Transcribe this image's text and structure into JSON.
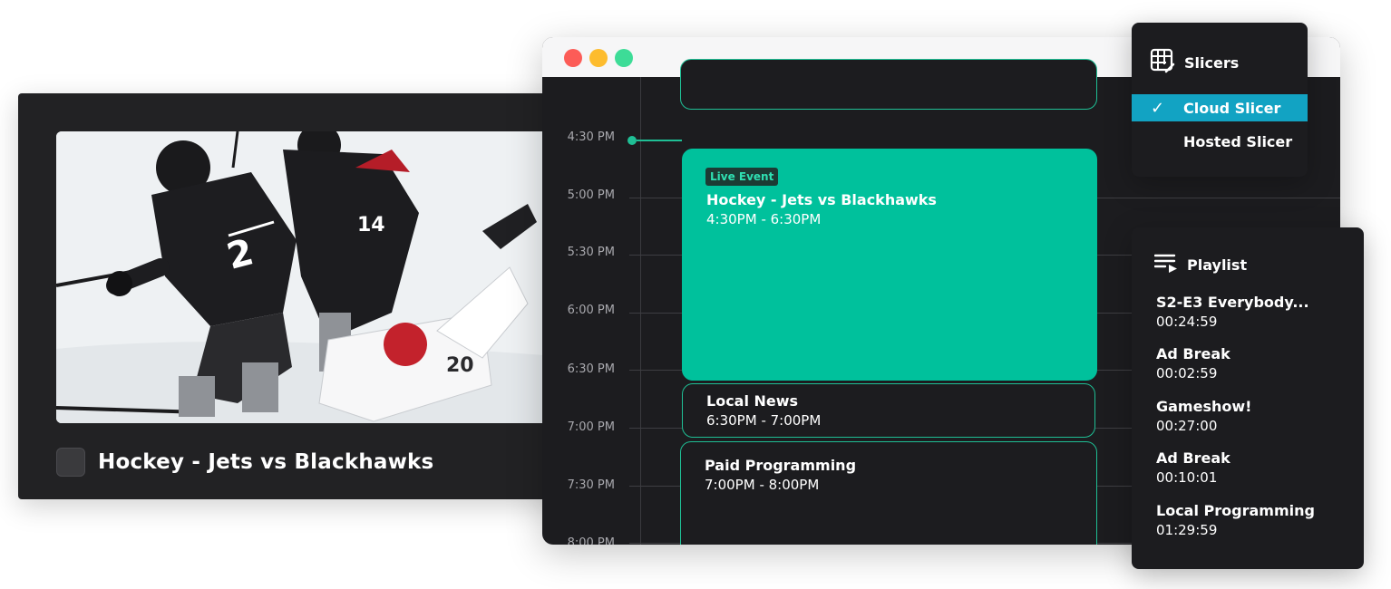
{
  "player": {
    "title": "Hockey - Jets vs Blackhawks"
  },
  "schedule": {
    "times": [
      "4:30 PM",
      "5:00 PM",
      "5:30 PM",
      "6:00 PM",
      "6:30 PM",
      "7:00 PM",
      "7:30 PM",
      "8:00 PM"
    ],
    "events": [
      {
        "badge": "Live Event",
        "title": "Hockey - Jets vs Blackhawks",
        "time": "4:30PM - 6:30PM"
      },
      {
        "title": "Local News",
        "time": "6:30PM - 7:00PM"
      },
      {
        "title": "Paid Programming",
        "time": "7:00PM - 8:00PM"
      }
    ]
  },
  "slicers": {
    "title": "Slicers",
    "options": [
      {
        "label": "Cloud Slicer",
        "selected": true
      },
      {
        "label": "Hosted Slicer",
        "selected": false
      }
    ]
  },
  "playlist": {
    "title": "Playlist",
    "items": [
      {
        "name": "S2-E3 Everybody...",
        "duration": "00:24:59"
      },
      {
        "name": "Ad Break",
        "duration": "00:02:59"
      },
      {
        "name": "Gameshow!",
        "duration": "00:27:00"
      },
      {
        "name": "Ad Break",
        "duration": "00:10:01"
      },
      {
        "name": "Local Programming",
        "duration": "01:29:59"
      }
    ]
  },
  "colors": {
    "accent_green": "#00c19c",
    "selection_blue": "#12a3c3",
    "panel_bg": "#1c1c1f"
  }
}
